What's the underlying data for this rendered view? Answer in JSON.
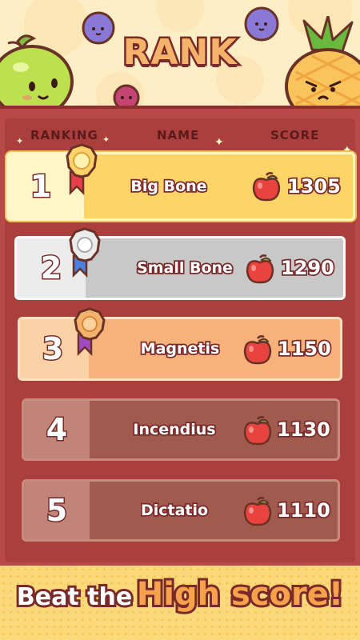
{
  "header": {
    "title": "RANK"
  },
  "columns": {
    "ranking": "RANKING",
    "name": "NAME",
    "score": "SCORE"
  },
  "rows": [
    {
      "rank": "1",
      "name": "Big Bone",
      "score": "1305",
      "medal": "gold",
      "icon": "apple-icon"
    },
    {
      "rank": "2",
      "name": "Small Bone",
      "score": "1290",
      "medal": "silver",
      "icon": "apple-icon"
    },
    {
      "rank": "3",
      "name": "Magnetis",
      "score": "1150",
      "medal": "bronze",
      "icon": "apple-icon"
    },
    {
      "rank": "4",
      "name": "Incendius",
      "score": "1130",
      "medal": "",
      "icon": "apple-icon"
    },
    {
      "rank": "5",
      "name": "Dictatio",
      "score": "1110",
      "medal": "",
      "icon": "apple-icon"
    }
  ],
  "footer": {
    "prefix": "Beat the",
    "highlight": "High score!"
  },
  "colors": {
    "board": "#b74a48",
    "gold_row": "#fbd974",
    "silver_row": "#c8c8c8",
    "bronze_row": "#f6b27a",
    "plain_row": "#a05a4e",
    "outline": "#7a2a2a"
  }
}
